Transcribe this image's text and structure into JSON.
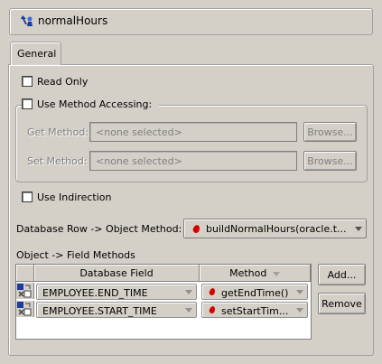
{
  "header": {
    "title": "normalHours",
    "icon": "mapping-attribute-icon"
  },
  "tabs": [
    {
      "label": "General",
      "active": true
    }
  ],
  "general": {
    "read_only_label": "Read Only",
    "read_only_checked": false,
    "use_method_accessing_label": "Use Method Accessing:",
    "use_method_accessing_checked": false,
    "get_method_label": "Get Method:",
    "get_method_value": "<none selected>",
    "set_method_label": "Set Method:",
    "set_method_value": "<none selected>",
    "browse_label": "Browse...",
    "use_indirection_label": "Use Indirection",
    "use_indirection_checked": false,
    "db_row_label": "Database Row -> Object Method:",
    "db_row_value": "buildNormalHours(oracle.t...",
    "field_methods_label": "Object -> Field Methods",
    "table": {
      "columns": [
        "Database Field",
        "Method"
      ],
      "rows": [
        {
          "field": "EMPLOYEE.END_TIME",
          "method": "getEndTime()"
        },
        {
          "field": "EMPLOYEE.START_TIME",
          "method": "setStartTim..."
        }
      ]
    },
    "add_button": "Add...",
    "remove_button": "Remove"
  },
  "colors": {
    "background": "#d4d0c8",
    "method_icon": "#d40000",
    "disabled_text": "#808080"
  }
}
